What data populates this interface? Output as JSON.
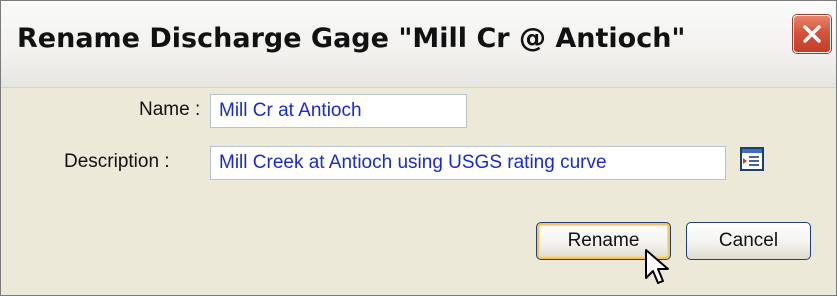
{
  "dialog": {
    "title": "Rename Discharge Gage \"Mill Cr @ Antioch\""
  },
  "fields": {
    "name_label": "Name :",
    "name_value": "Mill Cr at Antioch",
    "description_label": "Description :",
    "description_value": "Mill Creek at Antioch using USGS rating curve"
  },
  "buttons": {
    "rename_label": "Rename",
    "cancel_label": "Cancel"
  },
  "colors": {
    "field_text": "#1a2cc8",
    "close_button": "#d5533a",
    "default_button_highlight": "#f6c35e"
  },
  "icons": {
    "close": "close-icon",
    "browse": "text-editor-icon",
    "cursor": "mouse-pointer-icon"
  }
}
